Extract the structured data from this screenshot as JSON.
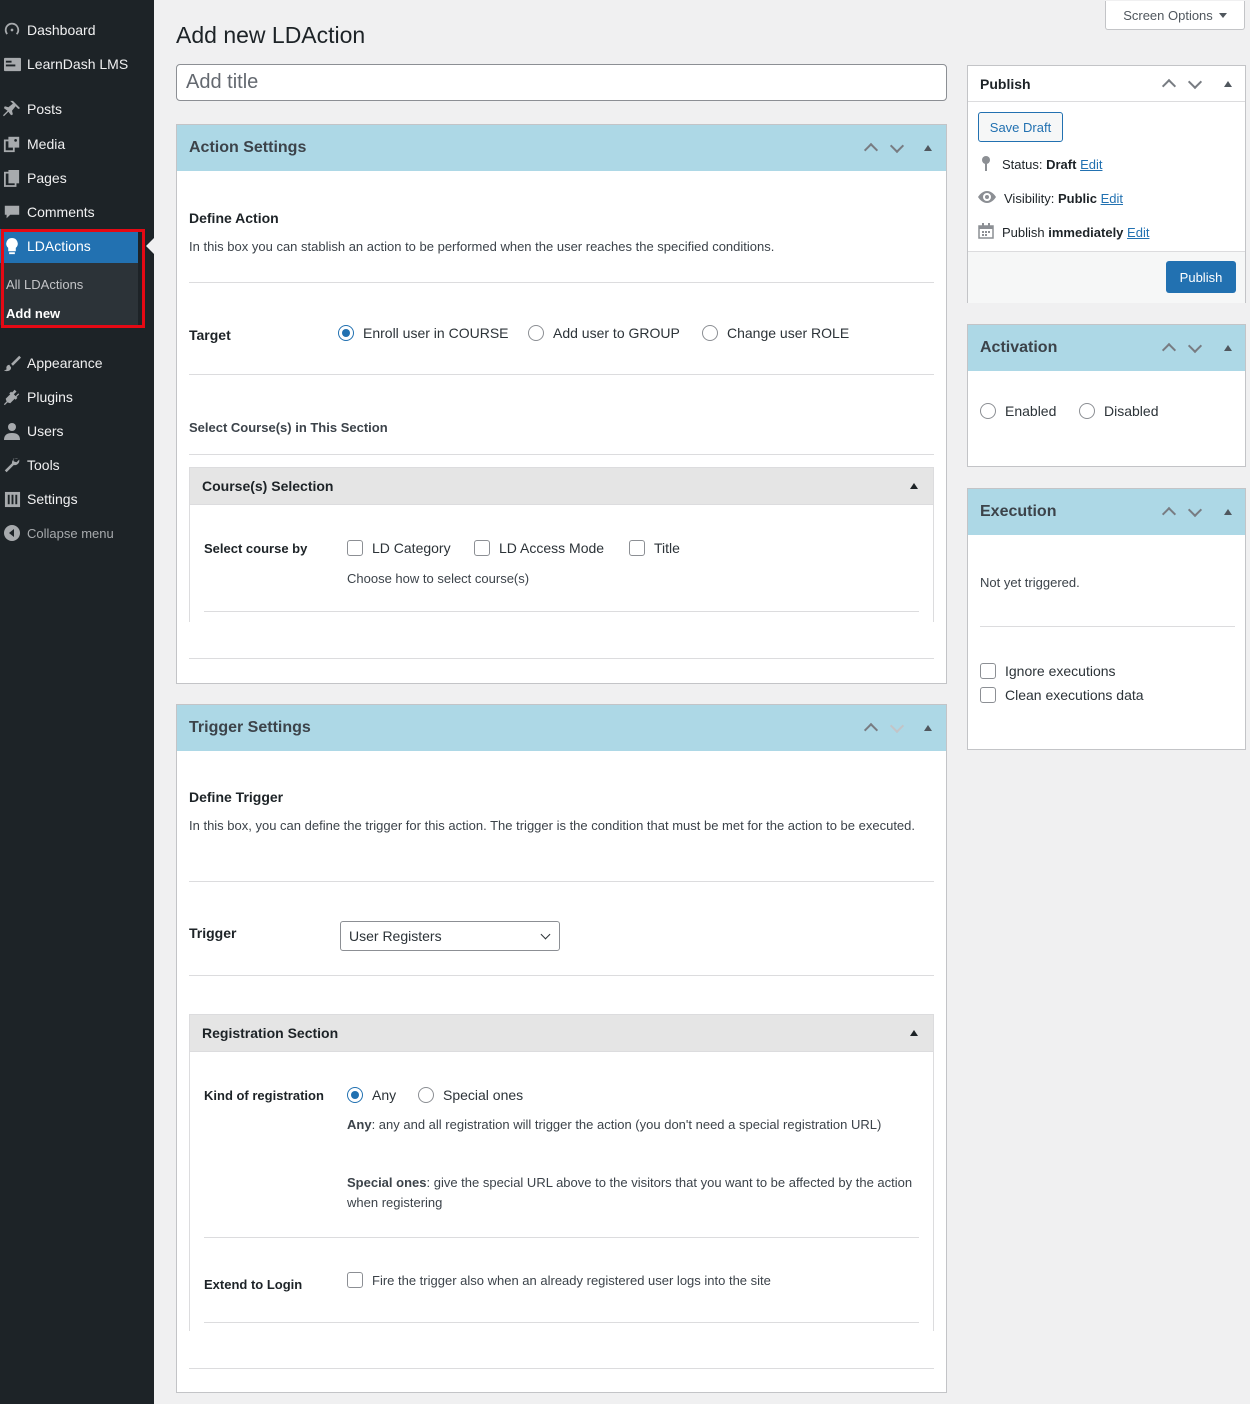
{
  "sidebar": {
    "items": [
      {
        "label": "Dashboard",
        "icon": "dashboard-icon"
      },
      {
        "label": "LearnDash LMS",
        "icon": "learndash-icon"
      },
      {
        "label": "Posts",
        "icon": "pin-icon"
      },
      {
        "label": "Media",
        "icon": "media-icon"
      },
      {
        "label": "Pages",
        "icon": "pages-icon"
      },
      {
        "label": "Comments",
        "icon": "comments-icon"
      },
      {
        "label": "LDActions",
        "icon": "lightbulb-icon"
      },
      {
        "label": "Appearance",
        "icon": "brush-icon"
      },
      {
        "label": "Plugins",
        "icon": "plug-icon"
      },
      {
        "label": "Users",
        "icon": "user-icon"
      },
      {
        "label": "Tools",
        "icon": "wrench-icon"
      },
      {
        "label": "Settings",
        "icon": "settings-icon"
      }
    ],
    "submenu": [
      "All LDActions",
      "Add new"
    ],
    "collapse": "Collapse menu"
  },
  "screen_options": "Screen Options",
  "page_title": "Add new LDAction",
  "title_placeholder": "Add title",
  "action_settings": {
    "heading": "Action Settings",
    "define_title": "Define Action",
    "define_desc": "In this box you can stablish an action to be performed when the user reaches the specified conditions.",
    "target_label": "Target",
    "target_options": [
      "Enroll user in COURSE",
      "Add user to GROUP",
      "Change user ROLE"
    ],
    "select_courses_heading": "Select Course(s) in This Section",
    "course_panel_title": "Course(s) Selection",
    "select_by_label": "Select course by",
    "select_by_options": [
      "LD Category",
      "LD Access Mode",
      "Title"
    ],
    "select_by_help": "Choose how to select course(s)"
  },
  "trigger_settings": {
    "heading": "Trigger Settings",
    "define_title": "Define Trigger",
    "define_desc": "In this box, you can define the trigger for this action. The trigger is the condition that must be met for the action to be executed.",
    "trigger_label": "Trigger",
    "trigger_value": "User Registers",
    "registration_panel_title": "Registration Section",
    "kind_label": "Kind of registration",
    "kind_options": [
      "Any",
      "Special ones"
    ],
    "any_term": "Any",
    "any_desc": ": any and all registration will trigger the action (you don't need a special registration URL)",
    "special_term": "Special ones",
    "special_desc": ": give the special URL above to the visitors that you want to be affected by the action when registering",
    "extend_label": "Extend to Login",
    "extend_option": "Fire the trigger also when an already registered user logs into the site"
  },
  "publish": {
    "heading": "Publish",
    "save_draft": "Save Draft",
    "status_label": "Status:",
    "status_value": "Draft",
    "visibility_label": "Visibility:",
    "visibility_value": "Public",
    "publish_label": "Publish",
    "publish_value": "immediately",
    "edit": "Edit",
    "publish_button": "Publish"
  },
  "activation": {
    "heading": "Activation",
    "options": [
      "Enabled",
      "Disabled"
    ]
  },
  "execution": {
    "heading": "Execution",
    "status": "Not yet triggered.",
    "options": [
      "Ignore executions",
      "Clean executions data"
    ]
  },
  "colors": {
    "accent": "#2271b1",
    "sidebar_bg": "#1d2327",
    "header_bg": "#add8e6",
    "highlight": "#e50914"
  }
}
